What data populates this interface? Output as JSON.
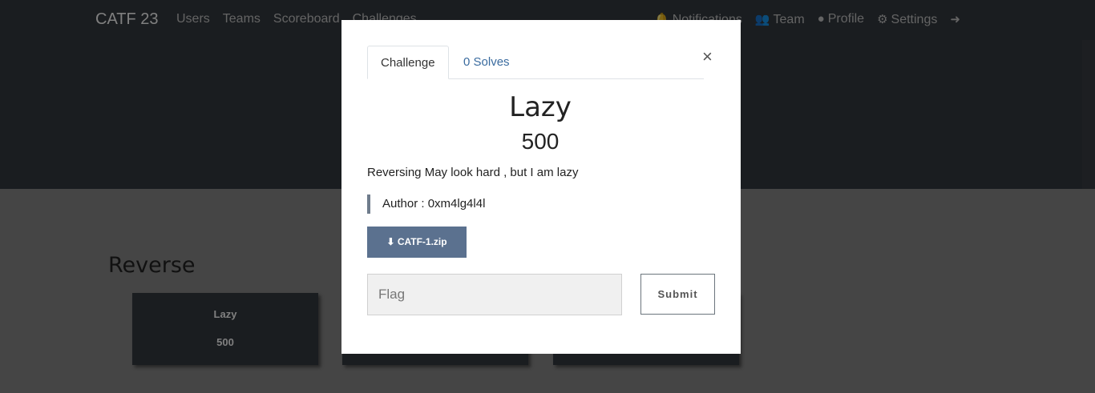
{
  "navbar": {
    "brand": "CATF 23",
    "left_links": [
      "Users",
      "Teams",
      "Scoreboard",
      "Challenges"
    ],
    "right_links": [
      {
        "icon": "bell-icon",
        "label": "Notifications"
      },
      {
        "icon": "users-icon",
        "label": "Team"
      },
      {
        "icon": "user-circle-icon",
        "label": "Profile"
      },
      {
        "icon": "cogs-icon",
        "label": "Settings"
      },
      {
        "icon": "sign-out-icon",
        "label": ""
      }
    ]
  },
  "board": {
    "category": "Reverse",
    "cards": [
      {
        "title": "Lazy",
        "value": "500"
      }
    ]
  },
  "modal": {
    "tabs": [
      "Challenge",
      "0 Solves"
    ],
    "close_symbol": "×",
    "challenge_name": "Lazy",
    "challenge_value": "500",
    "description": "Reversing May look hard , but I am lazy",
    "author": "Author : 0xm4lg4l4l",
    "file_label": "CATF-1.zip",
    "file_icon": "download-icon",
    "flag_placeholder": "Flag",
    "submit_label": "Submit"
  }
}
